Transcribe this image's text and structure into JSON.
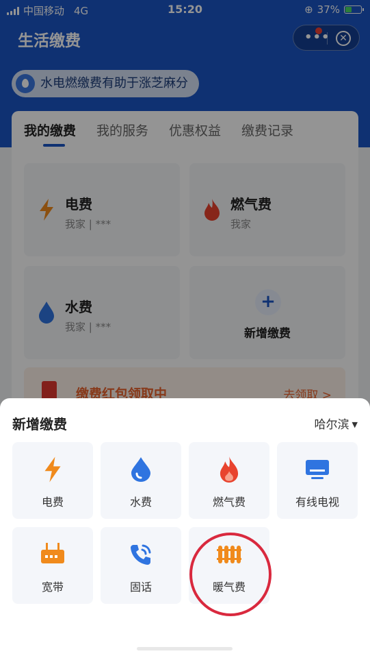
{
  "status_bar": {
    "carrier": "中国移动",
    "network": "4G",
    "time": "15:20",
    "battery": "37%"
  },
  "header": {
    "title": "生活缴费",
    "promo": "水电燃缴费有助于涨芝麻分"
  },
  "tabs": [
    {
      "label": "我的缴费",
      "active": true
    },
    {
      "label": "我的服务",
      "active": false
    },
    {
      "label": "优惠权益",
      "active": false
    },
    {
      "label": "缴费记录",
      "active": false
    }
  ],
  "bills": [
    {
      "name": "电费",
      "sub": "我家 | ***",
      "icon": "lightning-icon"
    },
    {
      "name": "燃气费",
      "sub": "我家",
      "icon": "flame-icon"
    },
    {
      "name": "水费",
      "sub": "我家 | ***",
      "icon": "water-drop-icon"
    }
  ],
  "add_bill": "新增缴费",
  "redpack": {
    "text": "缴费红包领取中",
    "action": "去领取 >"
  },
  "sheet": {
    "title": "新增缴费",
    "city": "哈尔滨",
    "items": [
      {
        "label": "电费",
        "icon": "lightning-icon"
      },
      {
        "label": "水费",
        "icon": "water-drop-icon"
      },
      {
        "label": "燃气费",
        "icon": "flame-icon"
      },
      {
        "label": "有线电视",
        "icon": "tv-icon"
      },
      {
        "label": "宽带",
        "icon": "router-icon"
      },
      {
        "label": "固话",
        "icon": "phone-icon"
      },
      {
        "label": "暖气费",
        "icon": "radiator-icon"
      }
    ]
  },
  "colors": {
    "brand_blue": "#1a55c4",
    "orange": "#f08a1c",
    "red": "#e8432e",
    "highlight_circle": "#d9293e"
  }
}
